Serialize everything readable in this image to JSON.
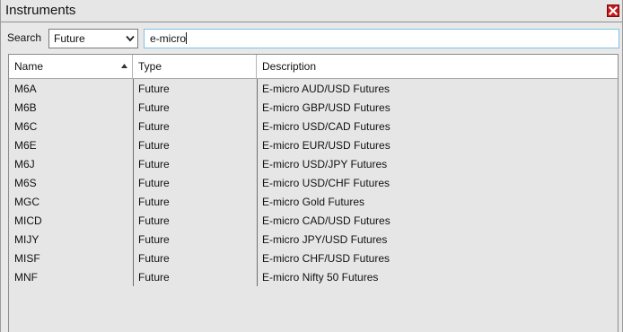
{
  "window": {
    "title": "Instruments"
  },
  "search": {
    "label": "Search",
    "type_selected": "Future",
    "query": "e-micro"
  },
  "table": {
    "columns": [
      "Name",
      "Type",
      "Description"
    ],
    "sort_column": "Name",
    "sort_direction": "ascending",
    "rows": [
      {
        "name": "M6A",
        "type": "Future",
        "description": "E-micro AUD/USD Futures"
      },
      {
        "name": "M6B",
        "type": "Future",
        "description": "E-micro GBP/USD Futures"
      },
      {
        "name": "M6C",
        "type": "Future",
        "description": "E-micro USD/CAD Futures"
      },
      {
        "name": "M6E",
        "type": "Future",
        "description": "E-micro EUR/USD Futures"
      },
      {
        "name": "M6J",
        "type": "Future",
        "description": "E-micro USD/JPY Futures"
      },
      {
        "name": "M6S",
        "type": "Future",
        "description": "E-micro USD/CHF Futures"
      },
      {
        "name": "MGC",
        "type": "Future",
        "description": "E-micro Gold Futures"
      },
      {
        "name": "MICD",
        "type": "Future",
        "description": "E-micro CAD/USD Futures"
      },
      {
        "name": "MIJY",
        "type": "Future",
        "description": "E-micro JPY/USD Futures"
      },
      {
        "name": "MISF",
        "type": "Future",
        "description": "E-micro CHF/USD Futures"
      },
      {
        "name": "MNF",
        "type": "Future",
        "description": "E-micro Nifty 50 Futures"
      }
    ]
  },
  "icons": {
    "close": "close-icon",
    "dropdown": "chevron-down-icon",
    "sort": "sort-ascending-icon"
  },
  "colors": {
    "close_button": "#c8191a",
    "input_focus_border": "#7ec2e6",
    "window_background": "#e8e8e8"
  }
}
